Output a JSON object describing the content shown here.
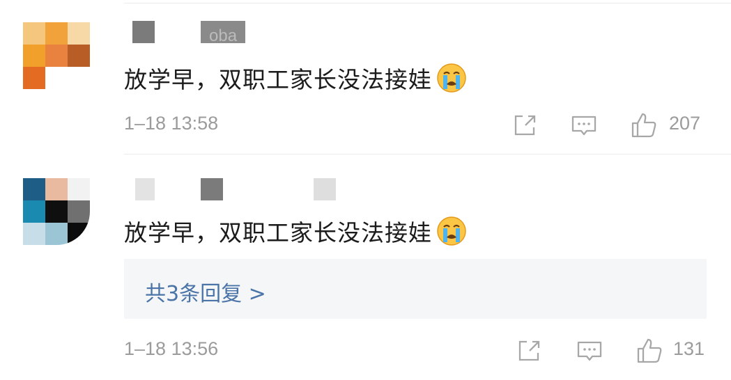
{
  "comments": [
    {
      "name_fragment": "oba",
      "text": "放学早，双职工家长没法接娃",
      "emoji": "crying-face-emoji",
      "time": "1–18 13:58",
      "likes": "207",
      "avatar_colors": [
        "#f5c77e",
        "#f2a23a",
        "#f6d9a6",
        "#f1a12b",
        "#e9813f",
        "#b75d25",
        "#e46b22",
        "#ffffff",
        "#ffffff"
      ]
    },
    {
      "name_fragment": "",
      "text": "放学早，双职工家长没法接娃",
      "emoji": "crying-face-emoji",
      "time": "1–18 13:56",
      "likes": "131",
      "replies_label": "共3条回复 >",
      "avatar_colors": [
        "#1e5e86",
        "#e9b9a0",
        "#f2f2f2",
        "#1a8ab1",
        "#0f0f0f",
        "#707070",
        "#c7dde7",
        "#9bc4d5",
        "#0c0c0c"
      ]
    }
  ],
  "icons": {
    "share": "share-icon",
    "comment": "comment-icon",
    "like": "thumbs-up-icon"
  }
}
